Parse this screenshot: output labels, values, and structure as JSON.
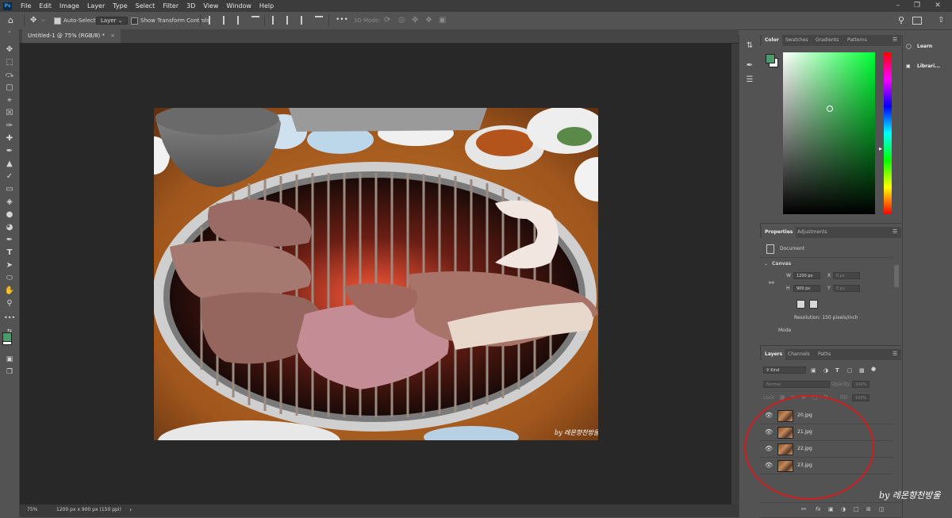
{
  "menubar": {
    "items": [
      "File",
      "Edit",
      "Image",
      "Layer",
      "Type",
      "Select",
      "Filter",
      "3D",
      "View",
      "Window",
      "Help"
    ]
  },
  "options": {
    "auto_select_label": "Auto-Select",
    "auto_select_value": "Layer",
    "show_transform_label": "Show Transform Controls",
    "mode_3d_label": "3D Mode:"
  },
  "document": {
    "tab_title": "Untitled-1 @ 75% (RGB/8) *",
    "photo_watermark": "by 레몬향천방울"
  },
  "status": {
    "zoom": "75%",
    "doc_info": "1200 px x 900 px (150 ppi)"
  },
  "color_panel": {
    "tabs": [
      "Color",
      "Swatches",
      "Gradients",
      "Patterns"
    ],
    "foreground_color": "#4a9a6a",
    "background_color": "#ffffff",
    "hue_color": "#00ff33"
  },
  "properties_panel": {
    "tabs": [
      "Properties",
      "Adjustments"
    ],
    "document_label": "Document",
    "canvas_label": "Canvas",
    "w_label": "W",
    "w_value": "1200 px",
    "h_label": "H",
    "h_value": "900 px",
    "x_label": "X",
    "x_value": "0 px",
    "y_label": "Y",
    "y_value": "0 px",
    "resolution": "Resolution: 150 pixels/inch",
    "mode_label": "Mode"
  },
  "layers_panel": {
    "tabs": [
      "Layers",
      "Channels",
      "Paths"
    ],
    "kind_label": "Kind",
    "blend_mode": "Normal",
    "opacity_label": "Opacity:",
    "opacity_value": "100%",
    "lock_label": "Lock:",
    "fill_label": "Fill:",
    "fill_value": "100%",
    "layers": [
      {
        "name": "20.jpg"
      },
      {
        "name": "21.jpg"
      },
      {
        "name": "22.jpg"
      },
      {
        "name": "23.jpg"
      }
    ]
  },
  "right_dock": {
    "learn_label": "Learn",
    "libraries_label": "Librari..."
  },
  "annotation": {
    "circle_color": "#d21c1c",
    "watermark": "by 레몬향천방울"
  }
}
